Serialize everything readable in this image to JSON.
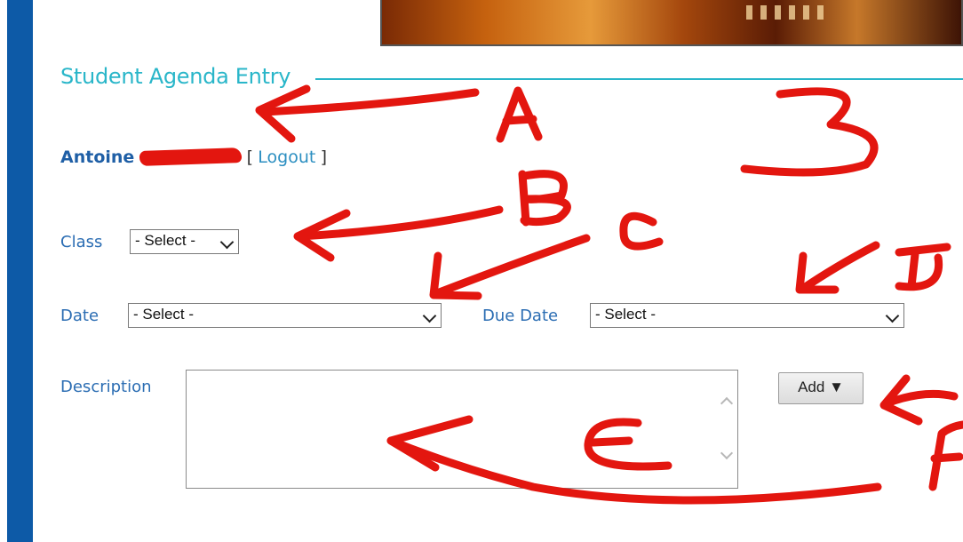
{
  "header": {
    "title": "Student Agenda Entry"
  },
  "user": {
    "name": "Antoine",
    "bracket_open": "[",
    "logout_label": "Logout",
    "bracket_close": "]"
  },
  "form": {
    "class": {
      "label": "Class",
      "value": "- Select -"
    },
    "date": {
      "label": "Date",
      "value": "- Select -"
    },
    "due_date": {
      "label": "Due Date",
      "value": "- Select -"
    },
    "description": {
      "label": "Description",
      "value": ""
    },
    "add_button": {
      "label": "Add ▼"
    }
  },
  "annotations": {
    "color": "#e3160f",
    "letters": [
      "A",
      "3",
      "B",
      "C",
      "D",
      "E",
      "F"
    ]
  },
  "colors": {
    "sidebar": "#0d5aa7",
    "title": "#29b6c9",
    "label": "#2b6db3",
    "link": "#2c8fc1"
  }
}
